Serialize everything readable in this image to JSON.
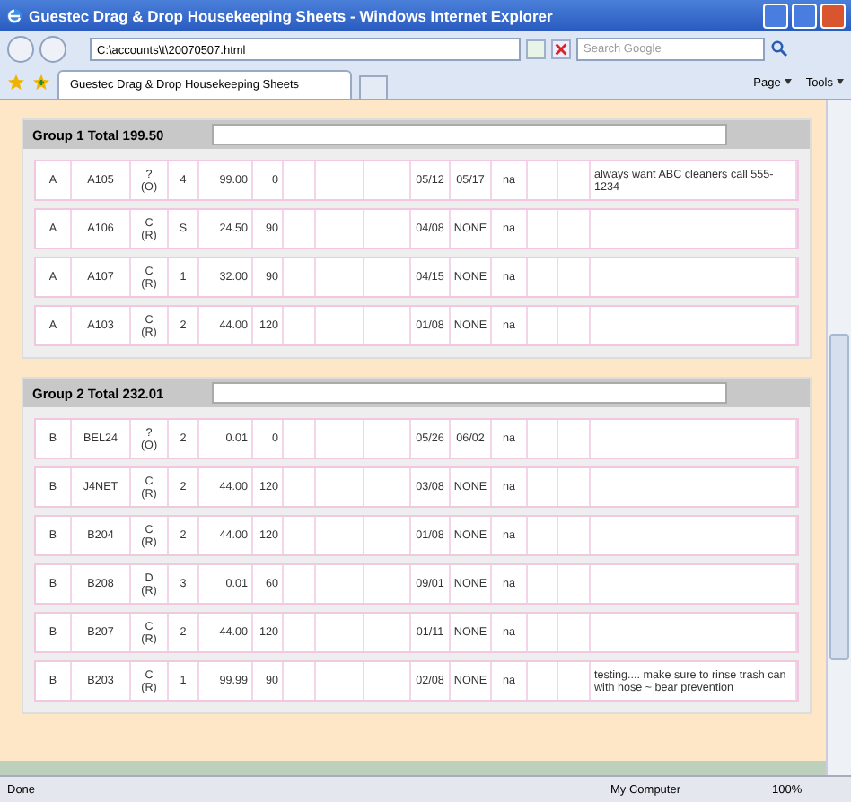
{
  "window": {
    "title": "Guestec Drag & Drop Housekeeping Sheets - Windows Internet Explorer"
  },
  "address_bar": {
    "value": "C:\\accounts\\t\\20070507.html"
  },
  "search": {
    "placeholder": "Search Google"
  },
  "tabs": [
    {
      "label": "Guestec Drag & Drop Housekeeping Sheets",
      "selected": true
    }
  ],
  "toolbar": [
    "Page",
    "Tools"
  ],
  "groups": [
    {
      "title": "Group 1 Total 199.50",
      "rows": [
        {
          "column_1": "A",
          "column_2": "A105",
          "column_3": [
            "?",
            "(O)"
          ],
          "column_4": "4",
          "column_5": "99.00",
          "column_6": "0",
          "column_10": "05/12",
          "column_11": "05/17",
          "column_12": "na",
          "column_15": "always want ABC cleaners call 555-1234"
        },
        {
          "column_1": "A",
          "column_2": "A106",
          "column_3": [
            "C",
            "(R)"
          ],
          "column_4": "S",
          "column_5": "24.50",
          "column_6": "90",
          "column_10": "04/08",
          "column_11": "NONE",
          "column_12": "na"
        },
        {
          "column_1": "A",
          "column_2": "A107",
          "column_3": [
            "C",
            "(R)"
          ],
          "column_4": "1",
          "column_5": "32.00",
          "column_6": "90",
          "column_10": "04/15",
          "column_11": "NONE",
          "column_12": "na"
        },
        {
          "column_1": "A",
          "column_2": "A103",
          "column_3": [
            "C",
            "(R)"
          ],
          "column_4": "2",
          "column_5": "44.00",
          "column_6": "120",
          "column_10": "01/08",
          "column_11": "NONE",
          "column_12": "na"
        }
      ]
    },
    {
      "title": "Group 2 Total 232.01",
      "rows": [
        {
          "column_1": "B",
          "column_2": "BEL24",
          "column_3": [
            "?",
            "(O)"
          ],
          "column_4": "2",
          "column_5": "0.01",
          "column_6": "0",
          "column_10": "05/26",
          "column_11": "06/02",
          "column_12": "na"
        },
        {
          "column_1": "B",
          "column_2": "J4NET",
          "column_3": [
            "C",
            "(R)"
          ],
          "column_4": "2",
          "column_5": "44.00",
          "column_6": "120",
          "column_10": "03/08",
          "column_11": "NONE",
          "column_12": "na"
        },
        {
          "column_1": "B",
          "column_2": "B204",
          "column_3": [
            "C",
            "(R)"
          ],
          "column_4": "2",
          "column_5": "44.00",
          "column_6": "120",
          "column_10": "01/08",
          "column_11": "NONE",
          "column_12": "na"
        },
        {
          "column_1": "B",
          "column_2": "B208",
          "column_3": [
            "D",
            "(R)"
          ],
          "column_4": "3",
          "column_5": "0.01",
          "column_6": "60",
          "column_10": "09/01",
          "column_11": "NONE",
          "column_12": "na"
        },
        {
          "column_1": "B",
          "column_2": "B207",
          "column_3": [
            "C",
            "(R)"
          ],
          "column_4": "2",
          "column_5": "44.00",
          "column_6": "120",
          "column_10": "01/11",
          "column_11": "NONE",
          "column_12": "na"
        },
        {
          "column_1": "B",
          "column_2": "B203",
          "column_3": [
            "C",
            "(R)"
          ],
          "column_4": "1",
          "column_5": "99.99",
          "column_6": "90",
          "column_10": "02/08",
          "column_11": "NONE",
          "column_12": "na",
          "column_15": "testing.... make sure to rinse trash can with hose ~ bear prevention"
        }
      ]
    }
  ],
  "status_bar": {
    "text": "Done",
    "zone": "My Computer",
    "zoom": "100%"
  }
}
